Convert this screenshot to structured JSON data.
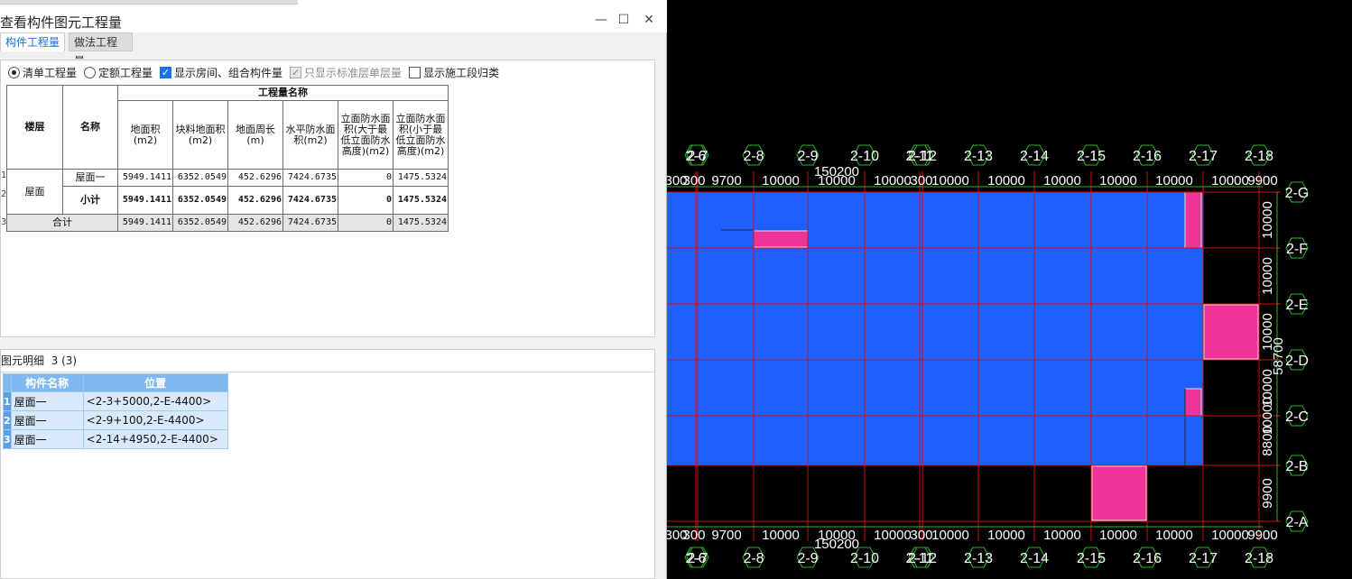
{
  "window": {
    "title": "查看构件图元工程量",
    "minimize": "—",
    "maximize": "☐",
    "close": "✕"
  },
  "tabs": [
    {
      "label": "构件工程量"
    },
    {
      "label": "做法工程量"
    }
  ],
  "options": {
    "radio_list": "清单工程量",
    "radio_quota": "定额工程量",
    "chk_show_rooms": "显示房间、组合构件量",
    "chk_std_floor": "只显示标准层单层量",
    "chk_construction": "显示施工段归类"
  },
  "quantity_table": {
    "group_header": "工程量名称",
    "col_floor": "楼层",
    "col_name": "名称",
    "columns": [
      "地面积(m2)",
      "块料地面积(m2)",
      "地面周长(m)",
      "水平防水面积(m2)",
      "立面防水面积(大于最低立面防水高度)(m2)",
      "立面防水面积(小于最低立面防水高度)(m2)"
    ],
    "row_numbers": [
      "1",
      "2",
      "3"
    ],
    "floor": "屋面",
    "rows": [
      {
        "name": "屋面一",
        "values": [
          "5949.1411",
          "6352.0549",
          "452.6296",
          "7424.6735",
          "0",
          "1475.5324"
        ]
      },
      {
        "name": "小计",
        "values": [
          "5949.1411",
          "6352.0549",
          "452.6296",
          "7424.6735",
          "0",
          "1475.5324"
        ]
      }
    ],
    "total": {
      "label": "合计",
      "values": [
        "5949.1411",
        "6352.0549",
        "452.6296",
        "7424.6735",
        "0",
        "1475.5324"
      ]
    }
  },
  "detail": {
    "label": "图元明细",
    "count": "3 (3)",
    "headers": [
      "构件名称",
      "位置"
    ],
    "rows": [
      {
        "idx": "1",
        "name": "屋面一",
        "pos": "<2-3+5000,2-E-4400>"
      },
      {
        "idx": "2",
        "name": "屋面一",
        "pos": "<2-9+100,2-E-4400>"
      },
      {
        "idx": "3",
        "name": "屋面一",
        "pos": "<2-14+4950,2-E-4400>"
      }
    ]
  },
  "cad": {
    "colors": {
      "background": "#000000",
      "slab": "#1f5fff",
      "pink": "#ee3399",
      "grid": "#cc1111",
      "axis_green": "#22bb22",
      "text": "#ffffff"
    },
    "x_axis_labels": [
      "2-6",
      "2-7",
      "2-8",
      "2-9",
      "2-10",
      "2-11",
      "2-12",
      "2-13",
      "2-14",
      "2-15",
      "2-16",
      "2-17",
      "2-18"
    ],
    "x_dims": [
      "300",
      "300",
      "9700",
      "10000",
      "10000",
      "10000",
      "300",
      "10000",
      "10000",
      "10000",
      "10000",
      "10000",
      "10000",
      "9900"
    ],
    "total_dim": "150200",
    "y_axis_labels": [
      "2-G",
      "2-F",
      "2-E",
      "2-D",
      "2-C",
      "2-B",
      "2-A"
    ],
    "y_dims": [
      "10000",
      "10000",
      "10000",
      "10000",
      "10000",
      "8800",
      "9900"
    ],
    "y_extra": "58700"
  }
}
